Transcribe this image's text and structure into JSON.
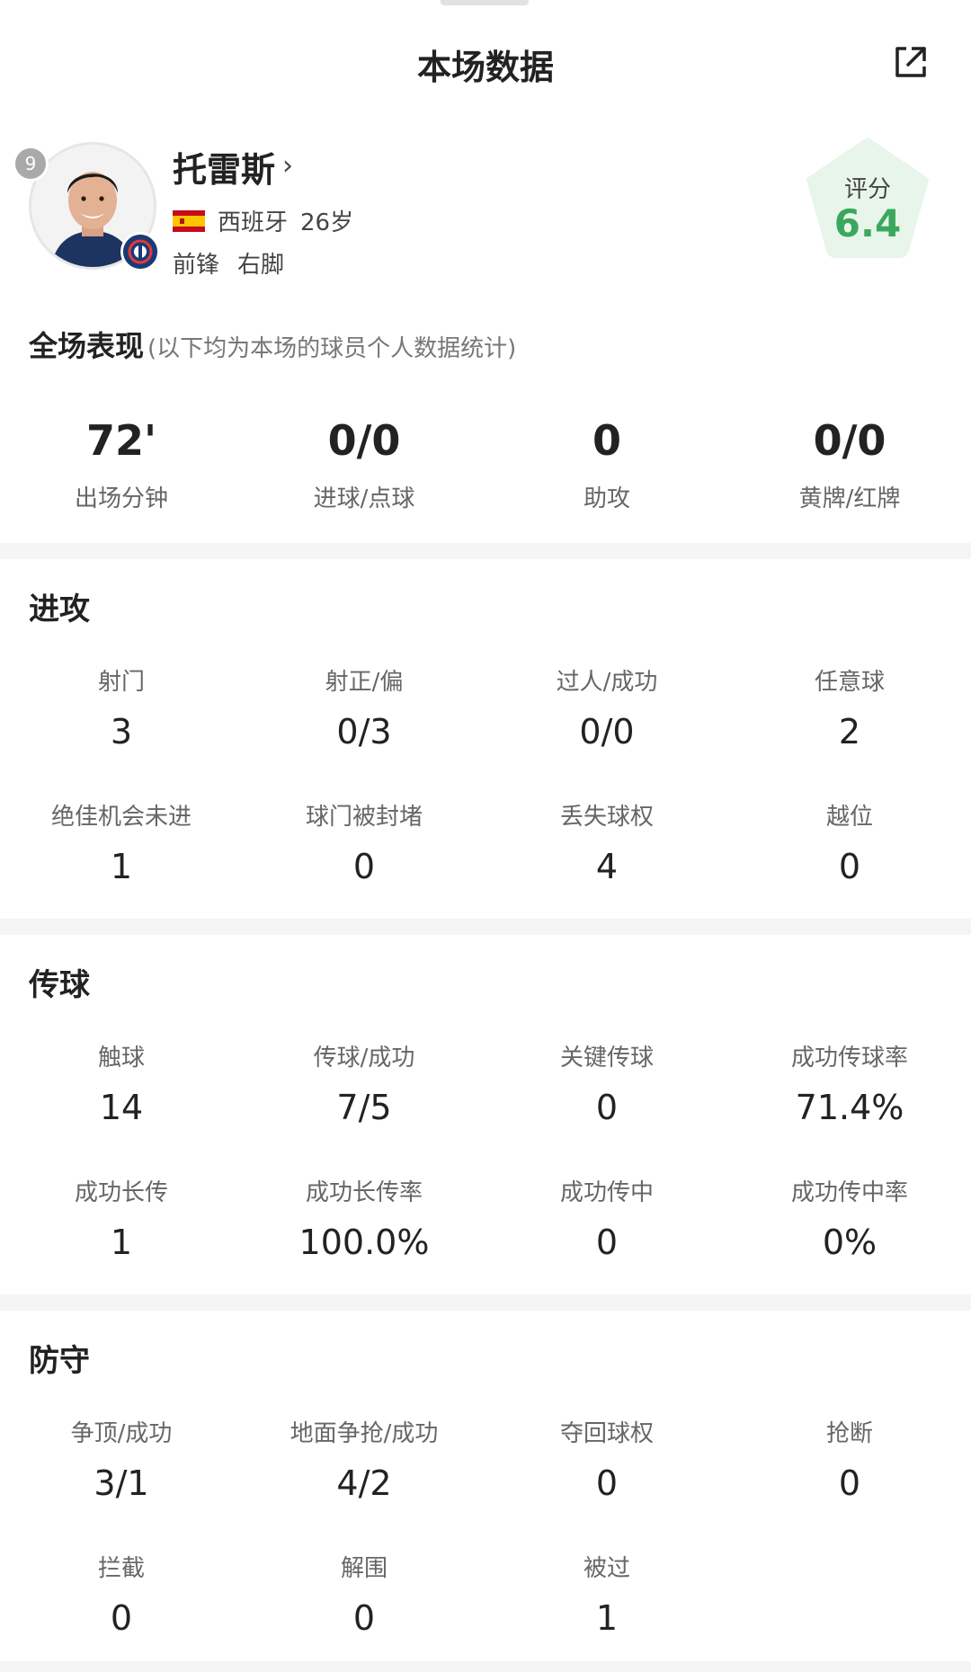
{
  "header": {
    "title": "本场数据",
    "share_icon": "share-external-icon"
  },
  "player": {
    "name": "托雷斯",
    "name_chevron": "›",
    "number": "9",
    "nationality": "西班牙",
    "age": "26岁",
    "position": "前锋",
    "foot": "右脚",
    "rating_label": "评分",
    "rating": "6.4",
    "rating_color": "#3aa85d"
  },
  "overview": {
    "title": "全场表现",
    "note": "(以下均为本场的球员个人数据统计)",
    "stats": [
      {
        "value": "72'",
        "label": "出场分钟"
      },
      {
        "value": "0/0",
        "label": "进球/点球"
      },
      {
        "value": "0",
        "label": "助攻"
      },
      {
        "value": "0/0",
        "label": "黄牌/红牌"
      }
    ]
  },
  "sections": {
    "attack": {
      "title": "进攻",
      "rows": [
        [
          {
            "label": "射门",
            "value": "3"
          },
          {
            "label": "射正/偏",
            "value": "0/3"
          },
          {
            "label": "过人/成功",
            "value": "0/0"
          },
          {
            "label": "任意球",
            "value": "2"
          }
        ],
        [
          {
            "label": "绝佳机会未进",
            "value": "1"
          },
          {
            "label": "球门被封堵",
            "value": "0"
          },
          {
            "label": "丢失球权",
            "value": "4"
          },
          {
            "label": "越位",
            "value": "0"
          }
        ]
      ]
    },
    "passing": {
      "title": "传球",
      "rows": [
        [
          {
            "label": "触球",
            "value": "14"
          },
          {
            "label": "传球/成功",
            "value": "7/5"
          },
          {
            "label": "关键传球",
            "value": "0"
          },
          {
            "label": "成功传球率",
            "value": "71.4%"
          }
        ],
        [
          {
            "label": "成功长传",
            "value": "1"
          },
          {
            "label": "成功长传率",
            "value": "100.0%"
          },
          {
            "label": "成功传中",
            "value": "0"
          },
          {
            "label": "成功传中率",
            "value": "0%"
          }
        ]
      ]
    },
    "defense": {
      "title": "防守",
      "rows": [
        [
          {
            "label": "争顶/成功",
            "value": "3/1"
          },
          {
            "label": "地面争抢/成功",
            "value": "4/2"
          },
          {
            "label": "夺回球权",
            "value": "0"
          },
          {
            "label": "抢断",
            "value": "0"
          }
        ],
        [
          {
            "label": "拦截",
            "value": "0"
          },
          {
            "label": "解围",
            "value": "0"
          },
          {
            "label": "被过",
            "value": "1"
          }
        ]
      ]
    }
  }
}
